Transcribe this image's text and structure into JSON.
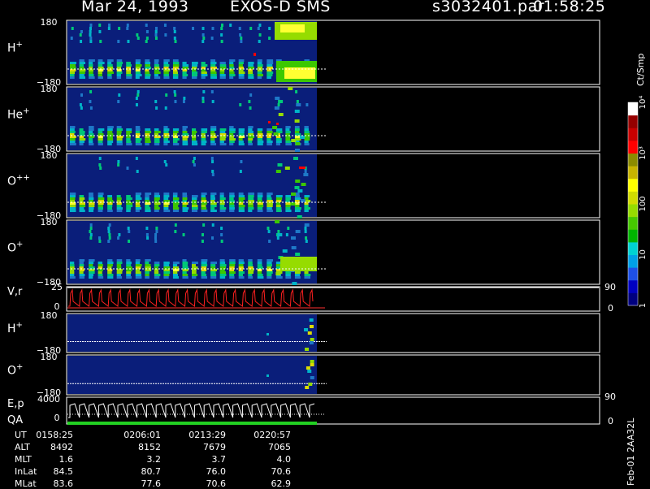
{
  "header": {
    "date": "Mar 24, 1993",
    "instrument": "EXOS-D SMS",
    "file": "s3032401.par",
    "time": "01:58:25"
  },
  "colorbar": {
    "unit_label": "Ct/Smp",
    "ticks": [
      {
        "label": "1",
        "value": 1
      },
      {
        "label": "10",
        "value": 10
      },
      {
        "label": "100",
        "value": 100
      },
      {
        "label": "10³",
        "value": 1000
      },
      {
        "label": "10⁴",
        "value": 10000
      }
    ],
    "colors": [
      "#00007f",
      "#0000c0",
      "#1e50e6",
      "#00a0e6",
      "#00d2d2",
      "#00b400",
      "#46c800",
      "#96dc00",
      "#d2dc00",
      "#ffff00",
      "#c8b400",
      "#8c8c00",
      "#ff0000",
      "#c80000",
      "#960000",
      "#ffffff"
    ]
  },
  "panels": [
    {
      "label_base": "H",
      "label_sup": "+",
      "y_top": "180",
      "y_bottom": "−180",
      "type": "spectrogram",
      "style": "H"
    },
    {
      "label_base": "He",
      "label_sup": "+",
      "y_top": "180",
      "y_bottom": "−180",
      "type": "spectrogram",
      "style": "He"
    },
    {
      "label_base": "O",
      "label_sup": "++",
      "y_top": "180",
      "y_bottom": "−180",
      "type": "spectrogram",
      "style": "O2"
    },
    {
      "label_base": "O",
      "label_sup": "+",
      "y_top": "180",
      "y_bottom": "−180",
      "type": "spectrogram",
      "style": "O"
    },
    {
      "label_base": "V,r",
      "label_sup": "",
      "y_top": "25",
      "y_bottom": "0",
      "right_top": "90",
      "right_bottom": "0",
      "type": "line"
    },
    {
      "label_base": "H",
      "label_sup": "+",
      "y_top": "180",
      "y_bottom": "−180",
      "type": "spectrogram",
      "style": "Hs"
    },
    {
      "label_base": "O",
      "label_sup": "+",
      "y_top": "180",
      "y_bottom": "−180",
      "type": "spectrogram",
      "style": "Os"
    },
    {
      "label_base": "E,p",
      "label_sup": "",
      "label2": "QA",
      "y_top": "4000",
      "y_bottom": "0",
      "right_top": "90",
      "right_bottom": "0",
      "type": "stairs"
    }
  ],
  "table": {
    "rows": [
      {
        "label": "UT",
        "values": [
          "0158:25",
          "0206:01",
          "0213:29",
          "0220:57"
        ]
      },
      {
        "label": "ALT",
        "values": [
          "8492",
          "8152",
          "7679",
          "7065"
        ]
      },
      {
        "label": "MLT",
        "values": [
          "1.6",
          "3.2",
          "3.7",
          "4.0"
        ]
      },
      {
        "label": "InLat",
        "values": [
          "84.5",
          "80.7",
          "76.0",
          "70.6"
        ]
      },
      {
        "label": "MLat",
        "values": [
          "83.6",
          "77.6",
          "70.6",
          "62.9"
        ]
      }
    ]
  },
  "footer_vertical": "Feb-01 2AA32L",
  "chart_data": {
    "type": "heatmap",
    "title": "Mar 24, 1993   EXOS-D SMS",
    "x_tick_labels": [
      "0158:25",
      "0206:01",
      "0213:29",
      "0220:57"
    ],
    "color_scale": "log",
    "color_range": [
      1,
      10000
    ],
    "color_unit": "Ct/Smp",
    "series": [
      {
        "name": "H+",
        "ylim": [
          -180,
          180
        ]
      },
      {
        "name": "He+",
        "ylim": [
          -180,
          180
        ]
      },
      {
        "name": "O++",
        "ylim": [
          -180,
          180
        ]
      },
      {
        "name": "O+",
        "ylim": [
          -180,
          180
        ]
      },
      {
        "name": "V,r",
        "ylim": [
          0,
          25
        ],
        "ylim_right": [
          0,
          90
        ]
      },
      {
        "name": "H+",
        "ylim": [
          -180,
          180
        ]
      },
      {
        "name": "O+",
        "ylim": [
          -180,
          180
        ]
      },
      {
        "name": "E,p",
        "ylim": [
          0,
          4000
        ],
        "ylim_right": [
          0,
          90
        ]
      },
      {
        "name": "QA"
      }
    ]
  }
}
